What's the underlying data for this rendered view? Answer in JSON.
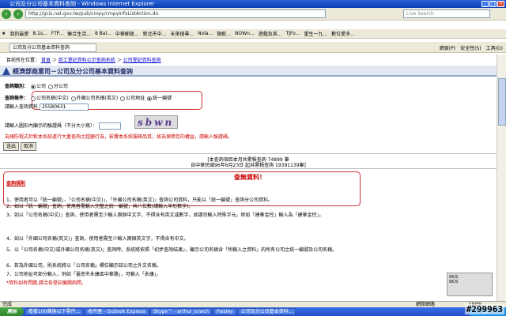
{
  "window": {
    "title": "公司及分公司基本資料查詢 - Windows Internet Explorer"
  },
  "browser": {
    "url": "http://gcis.nat.gov.tw/pub/cmpy/cmpyInfoListAction.do",
    "search_placeholder": "Live Search",
    "favorites": [
      "我的最愛",
      "8.1s...",
      "FTP...",
      "聯合生活...",
      "8 Bal...",
      "中華郵政...",
      "新北市中...",
      "未來搜尋...",
      "Nola...",
      "微軟...",
      "NOWn...",
      "遊戲及其...",
      "TJFo...",
      "重生一九...",
      "數位愛多..."
    ],
    "tab": "公司及分公司基本資料查詢",
    "tools": [
      "網頁(P)",
      "安全性(S)",
      "工具(O)"
    ]
  },
  "breadcrumb": {
    "prefix": "目前所在位置：",
    "items": [
      "首頁",
      "商工登記資料公示查詢系統",
      "公司登記資料查詢"
    ]
  },
  "header": {
    "title": "經濟部商業司－公司及分公司基本資料查詢"
  },
  "query_type": {
    "label": "查詢類別：",
    "options": [
      "公司",
      "分公司"
    ],
    "selected": 0
  },
  "query_cond": {
    "label": "查詢條件：",
    "options": [
      "公司名稱(中文)",
      "外國公司名稱(英文)",
      "公司地址",
      "統一編號"
    ],
    "selected": 3
  },
  "input": {
    "label": "請輸入查詢資料",
    "value": "25580631"
  },
  "captcha": {
    "label": "請輸入圖形內顯示的驗證碼（不分大小寫）：",
    "text": "sbwn"
  },
  "warning": "為預防程式針對本系統進行大量查詢之超額行為，影響本系統服務品質，故為保障您的權益，請輸入驗證碼。",
  "buttons": {
    "submit": "送出",
    "reset": "取消"
  },
  "stats": {
    "line1": "[本查詢項目本月共累積查詢 74899 筆",
    "line2": "自中華民國96年6月23日 起共累積查詢 19391139筆]"
  },
  "result": "查無資料！",
  "notes": {
    "title": "查詢規則",
    "items": [
      "1、使用者可以「統一編號」、「公司名稱(中文)」、「外國公司名稱(英文)」查詢公司資料，只能以「統一編號」查詢分公司資料。",
      "2、如以「統一編號」查詢，使用者需輸入完整之統一編號，共八位數(請輸入半形數字)。",
      "3、如以「公司名稱(中文)」查詢，使用者需至少輸入兩個中文字，不得含有英文或數字，並請勿輸入特殊字元。例如「建華金控」輸入為「建華金控」。",
      "4、如以「外國公司名稱(英文)」查詢，使用者需至少輸入兩個英文字，不得含有中文。",
      "5、以「公司名稱(中文)或外國公司名稱(英文)」查詢時，系統將依照「初步查詢結果」，顯示公司名稱含「所輸入之資料」的所有公司之統一編號及公司名稱。",
      "6、若為外國公司，則系統將以「公司名稱」欄位顯示該公司之外文名稱。",
      "7、公司地址可部分輸入，例如「臺南市永康區中華路」，可輸入「永康」。"
    ],
    "footer": "*資料如有問題,請洽各登記機關詢問。"
  },
  "status": {
    "left": "完成",
    "zone": "網際網路",
    "zoom": "100%"
  },
  "taskbar": {
    "start": "開始",
    "items": [
      "看看100萬換以下零件...",
      "收件匣 - Outlook Express",
      "Skype™ - arthur_scwch",
      "Paisley",
      "公司及分公司基本資料..."
    ],
    "clock": "上午"
  },
  "watermark": "#299963",
  "dialog": {
    "line1": "0K/S",
    "line2": "0K/S"
  }
}
